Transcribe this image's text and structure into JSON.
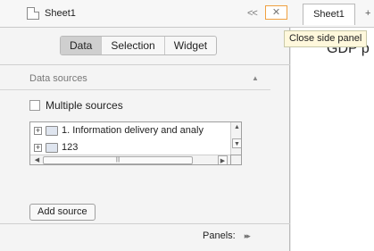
{
  "header": {
    "page_name": "Sheet1",
    "collapse_arrows": "<<",
    "close_glyph": "✕"
  },
  "tooltip": {
    "text": "Close side panel"
  },
  "tabs": {
    "sheet": "Sheet1",
    "add": "+"
  },
  "content": {
    "title": "GDP p"
  },
  "side_panel": {
    "segments": [
      "Data",
      "Selection",
      "Widget"
    ],
    "section_title": "Data sources",
    "multiple_sources_label": "Multiple sources",
    "sources": [
      "1. Information delivery and analy",
      "123"
    ],
    "add_source_label": "Add source",
    "footer_label": "Panels:"
  }
}
